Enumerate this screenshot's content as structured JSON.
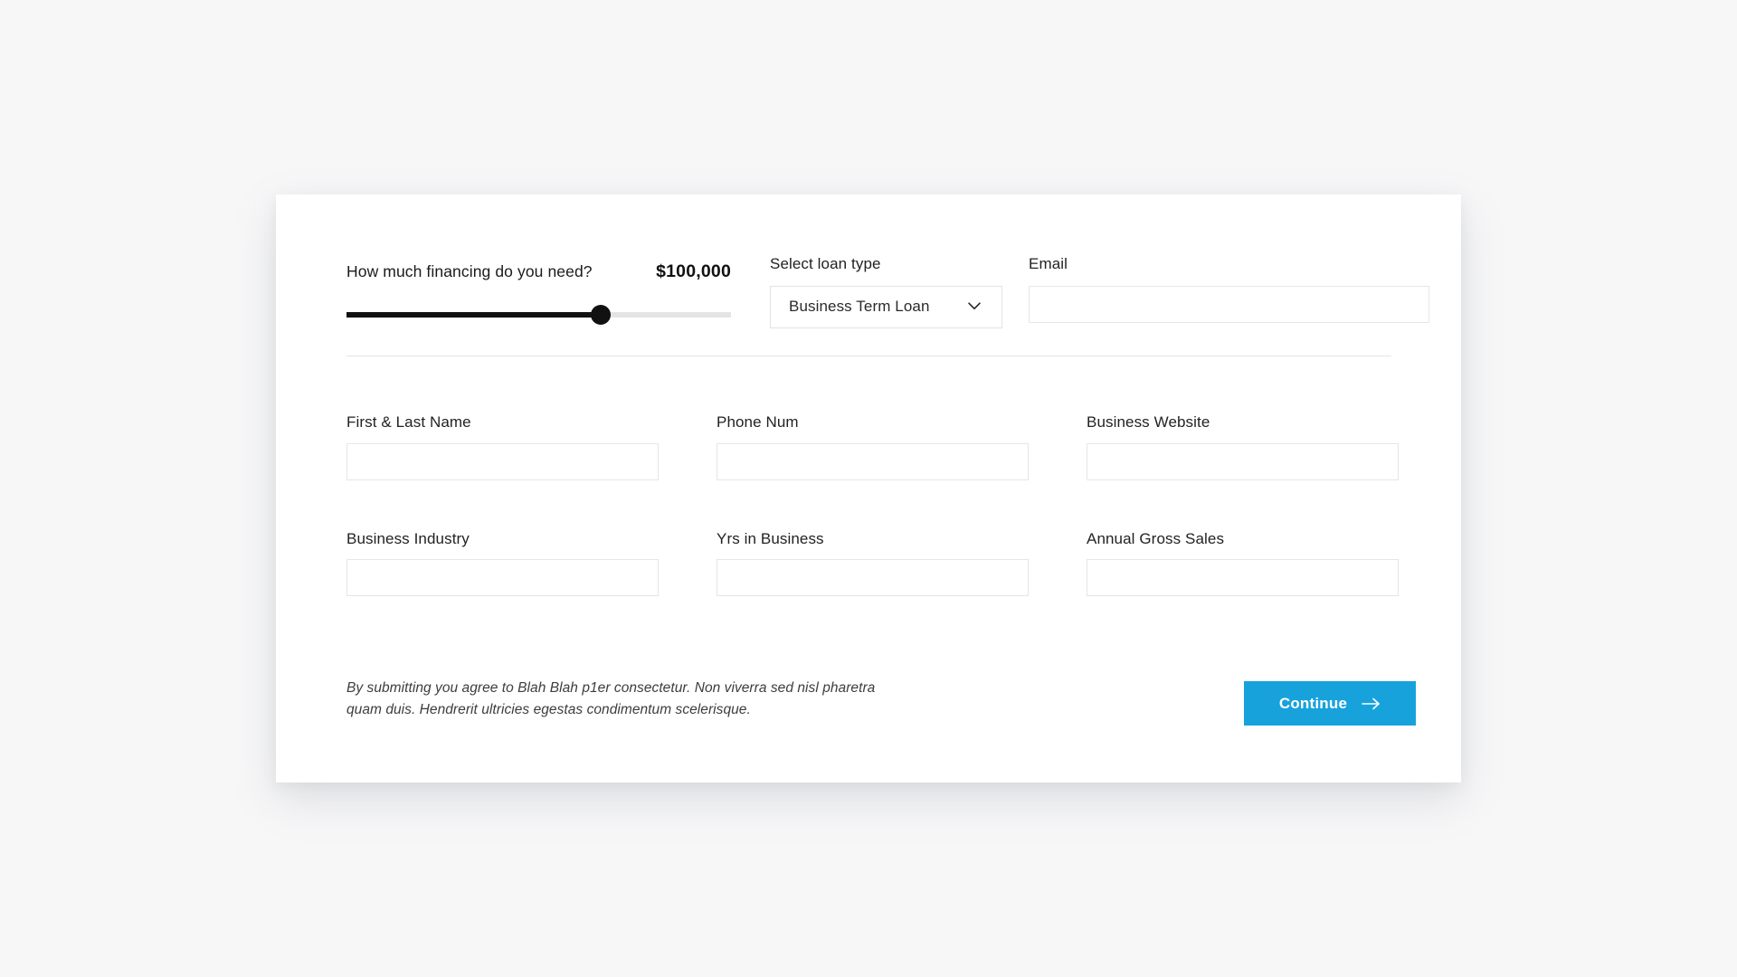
{
  "theme": {
    "page_background": "#f7f7f8",
    "card_background": "#ffffff",
    "accent": "#17a2dc",
    "slider_fill": "#111111",
    "slider_track": "#e4e4e4",
    "border": "#e6e6e6"
  },
  "financing": {
    "question": "How much financing do you need?",
    "amount": "$100,000",
    "slider_fill_percent": 66
  },
  "loan_type": {
    "label": "Select loan type",
    "selected": "Business Term Loan",
    "chevron_icon": "chevron-down-icon"
  },
  "email": {
    "label": "Email",
    "value": "",
    "placeholder": ""
  },
  "fields": [
    {
      "label": "First & Last Name",
      "value": "",
      "placeholder": ""
    },
    {
      "label": "Phone Num",
      "value": "",
      "placeholder": ""
    },
    {
      "label": "Business Website",
      "value": "",
      "placeholder": ""
    },
    {
      "label": "Business Industry",
      "value": "",
      "placeholder": ""
    },
    {
      "label": "Yrs in Business",
      "value": "",
      "placeholder": ""
    },
    {
      "label": "Annual Gross Sales",
      "value": "",
      "placeholder": ""
    }
  ],
  "footer": {
    "disclaimer": "By submitting you agree to Blah Blah p1er consectetur. Non viverra sed nisl pharetra quam duis. Hendrerit ultricies egestas condimentum scelerisque.",
    "continue_label": "Continue",
    "arrow_icon": "arrow-right-icon"
  }
}
